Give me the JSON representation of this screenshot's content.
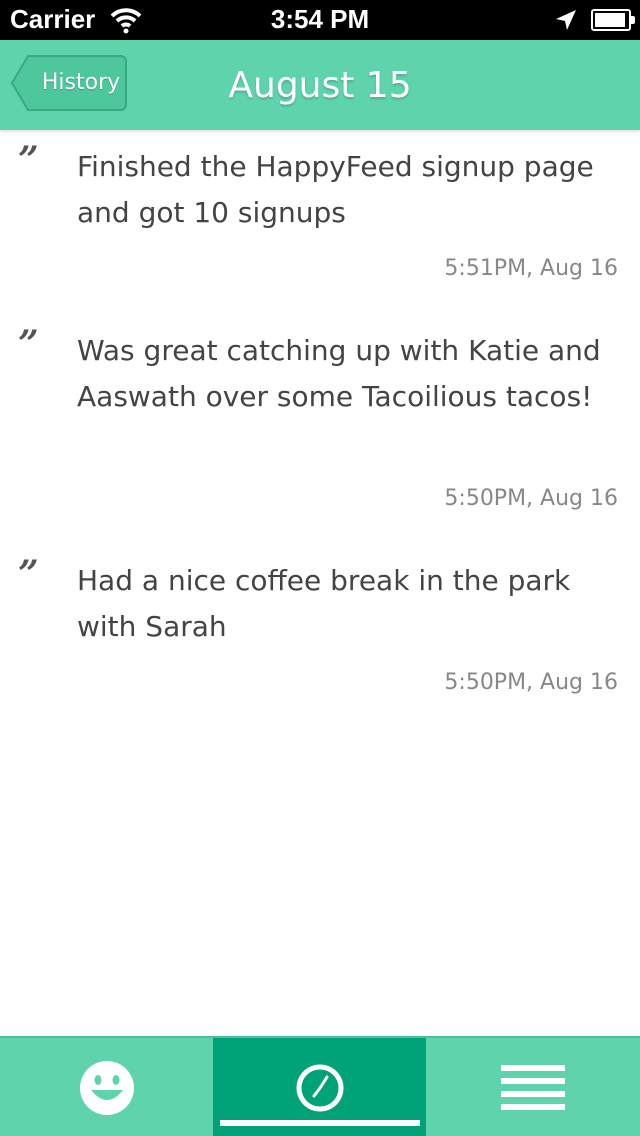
{
  "status_bar": {
    "carrier": "Carrier",
    "time": "3:54 PM",
    "battery_level": 0.95,
    "icons": [
      "wifi-icon",
      "location-arrow-icon",
      "battery-icon"
    ]
  },
  "nav": {
    "back_label": "History",
    "title": "August 15"
  },
  "entries": [
    {
      "text": "Finished the HappyFeed signup page and got 10 signups",
      "time": "5:51PM, Aug 16"
    },
    {
      "text": "Was great catching up with Katie and Aaswath over some Tacoilious tacos!",
      "time": "5:50PM, Aug 16"
    },
    {
      "text": "Had a nice coffee break in the park with Sarah",
      "time": "5:50PM, Aug 16"
    }
  ],
  "quote_glyph": "”",
  "tab_bar": {
    "tabs": [
      {
        "icon": "smiley-icon",
        "selected": false
      },
      {
        "icon": "clock-icon",
        "selected": true
      },
      {
        "icon": "menu-lines-icon",
        "selected": false
      }
    ]
  },
  "colors": {
    "accent": "#5fd4ac",
    "selected_tab": "#00a278",
    "text": "#444444",
    "timestamp": "#888888"
  }
}
